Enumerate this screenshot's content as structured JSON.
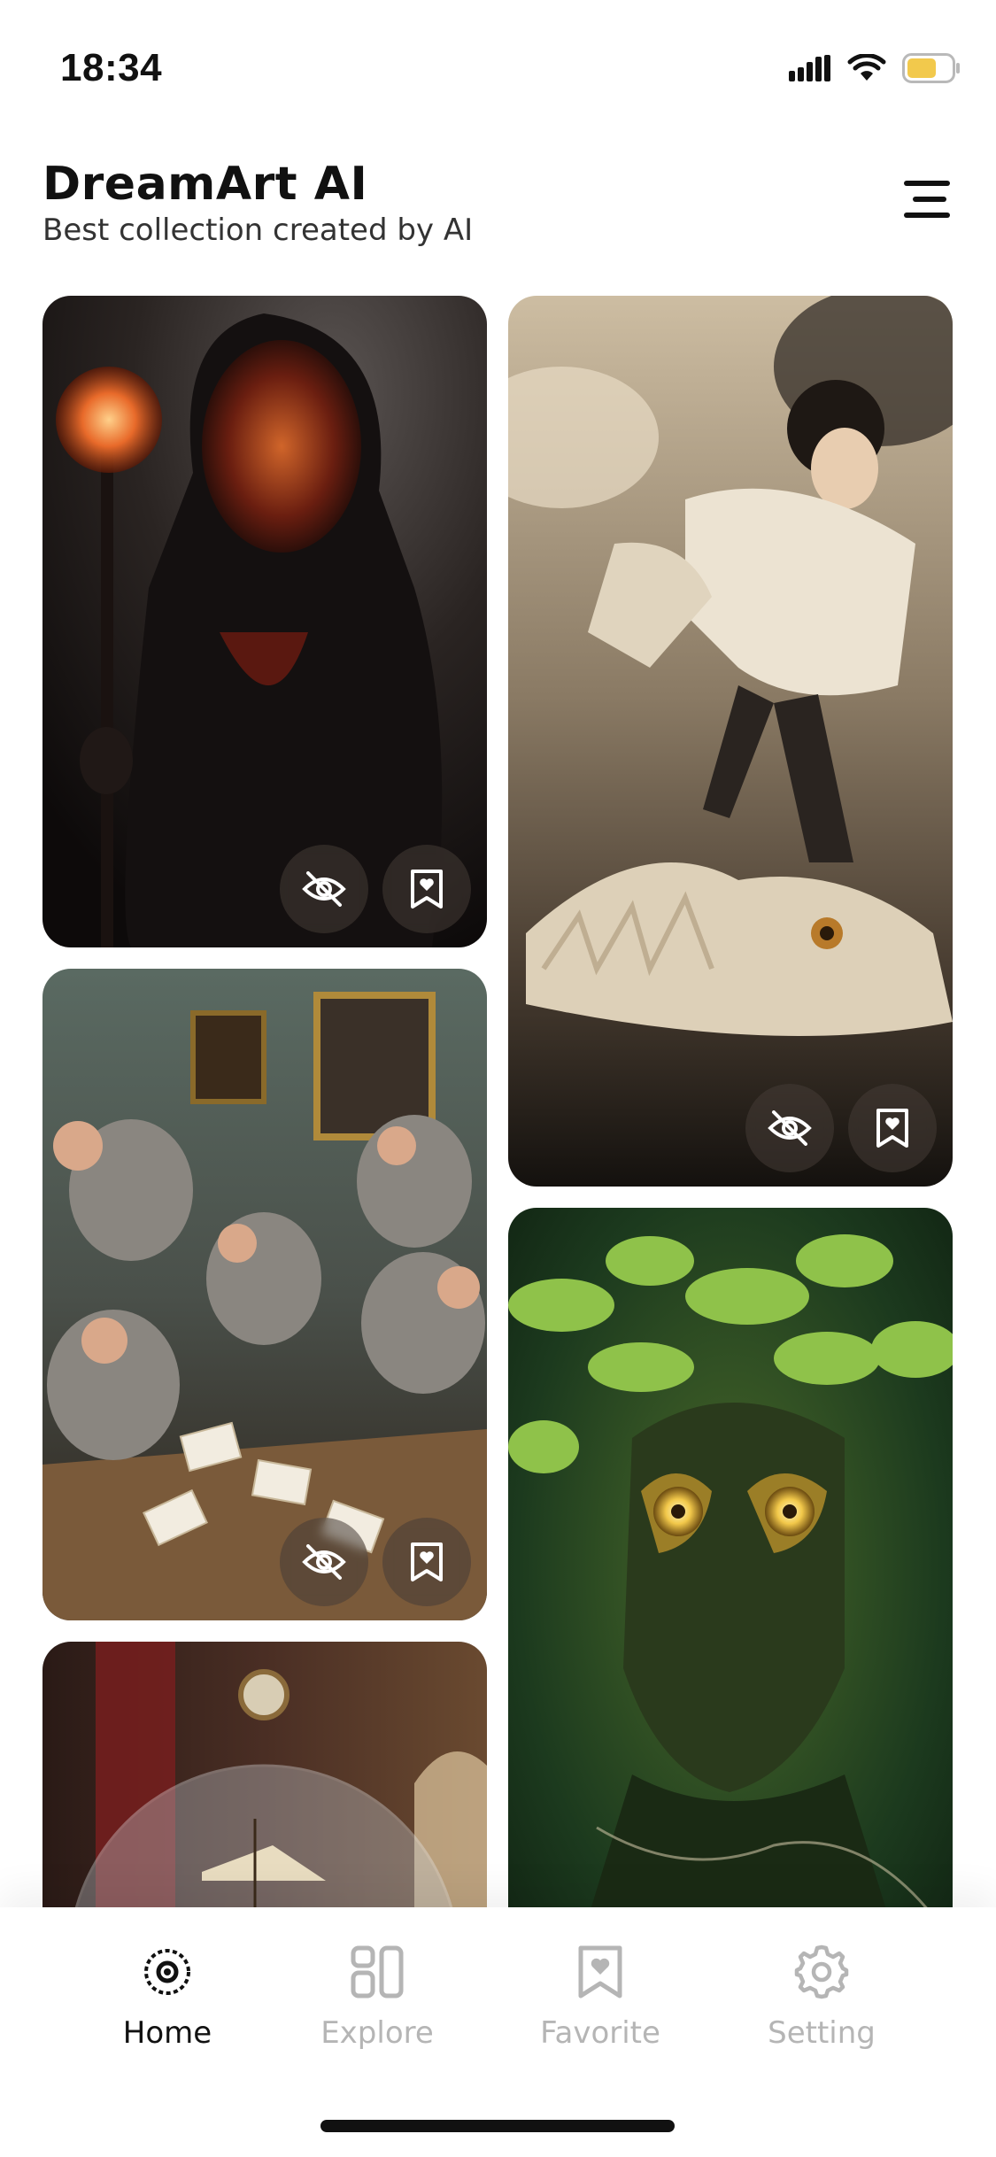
{
  "status_bar": {
    "time": "18:34",
    "battery_color": "#f2c94c"
  },
  "header": {
    "title": "DreamArt AI",
    "subtitle": "Best collection created by AI",
    "menu_icon": "menu-lines-icon"
  },
  "feed": {
    "cards": [
      {
        "id": "card-hooded-figure",
        "subject": "hooded-figure-with-glowing-staff",
        "colors": [
          "#2a2422",
          "#0f0c0c",
          "#e86a2a"
        ],
        "actions": [
          "hide-icon",
          "bookmark-icon"
        ]
      },
      {
        "id": "card-warrior-dragon",
        "subject": "warrior-on-dragon",
        "colors": [
          "#d8c8ae",
          "#6a5a48",
          "#1e1a16"
        ],
        "actions": [
          "hide-icon",
          "bookmark-icon"
        ]
      },
      {
        "id": "card-rats-cards",
        "subject": "rats-playing-cards",
        "colors": [
          "#5a6a62",
          "#7a5a3a",
          "#c8b89a"
        ],
        "actions": [
          "hide-icon",
          "bookmark-icon"
        ]
      },
      {
        "id": "card-tree-face",
        "subject": "tree-face-with-leaves",
        "colors": [
          "#1c3a1e",
          "#8fc24a",
          "#d9b04a"
        ],
        "actions": []
      },
      {
        "id": "card-ship-globe",
        "subject": "ship-in-glass-globe",
        "colors": [
          "#3a2420",
          "#7a1e1e",
          "#b8a88a"
        ],
        "actions": []
      }
    ]
  },
  "bottom_nav": {
    "items": [
      {
        "label": "Home",
        "icon": "home-target-icon",
        "active": true
      },
      {
        "label": "Explore",
        "icon": "explore-grid-icon",
        "active": false
      },
      {
        "label": "Favorite",
        "icon": "favorite-bookmark-icon",
        "active": false
      },
      {
        "label": "Setting",
        "icon": "gear-icon",
        "active": false
      }
    ]
  }
}
